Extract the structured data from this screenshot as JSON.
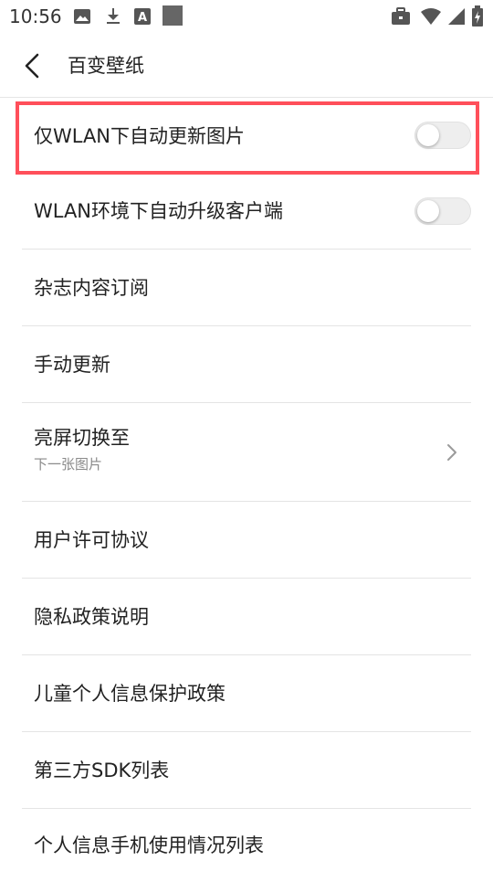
{
  "status_bar": {
    "time": "10:56",
    "icons": [
      "image-icon",
      "download-icon",
      "text-recognition-icon",
      "app-square-icon",
      "briefcase-icon",
      "wifi-icon",
      "signal-icon",
      "battery-icon"
    ]
  },
  "header": {
    "back_icon": "chevron-left-icon",
    "title": "百变壁纸"
  },
  "settings": [
    {
      "label": "仅WLAN下自动更新图片",
      "control": "toggle",
      "on": false
    },
    {
      "label": "WLAN环境下自动升级客户端",
      "control": "toggle",
      "on": false
    },
    {
      "label": "杂志内容订阅"
    },
    {
      "label": "手动更新"
    },
    {
      "label": "亮屏切换至",
      "sub": "下一张图片",
      "control": "chevron"
    },
    {
      "label": "用户许可协议"
    },
    {
      "label": "隐私政策说明"
    },
    {
      "label": "儿童个人信息保护政策"
    },
    {
      "label": "第三方SDK列表"
    },
    {
      "label": "个人信息手机使用情况列表"
    }
  ],
  "colors": {
    "highlight_border": "#ff4f5a",
    "text_primary": "#222222",
    "text_secondary": "#8a8a8a",
    "divider": "#e4e4e4",
    "toggle_off_track": "#eeeeee"
  }
}
